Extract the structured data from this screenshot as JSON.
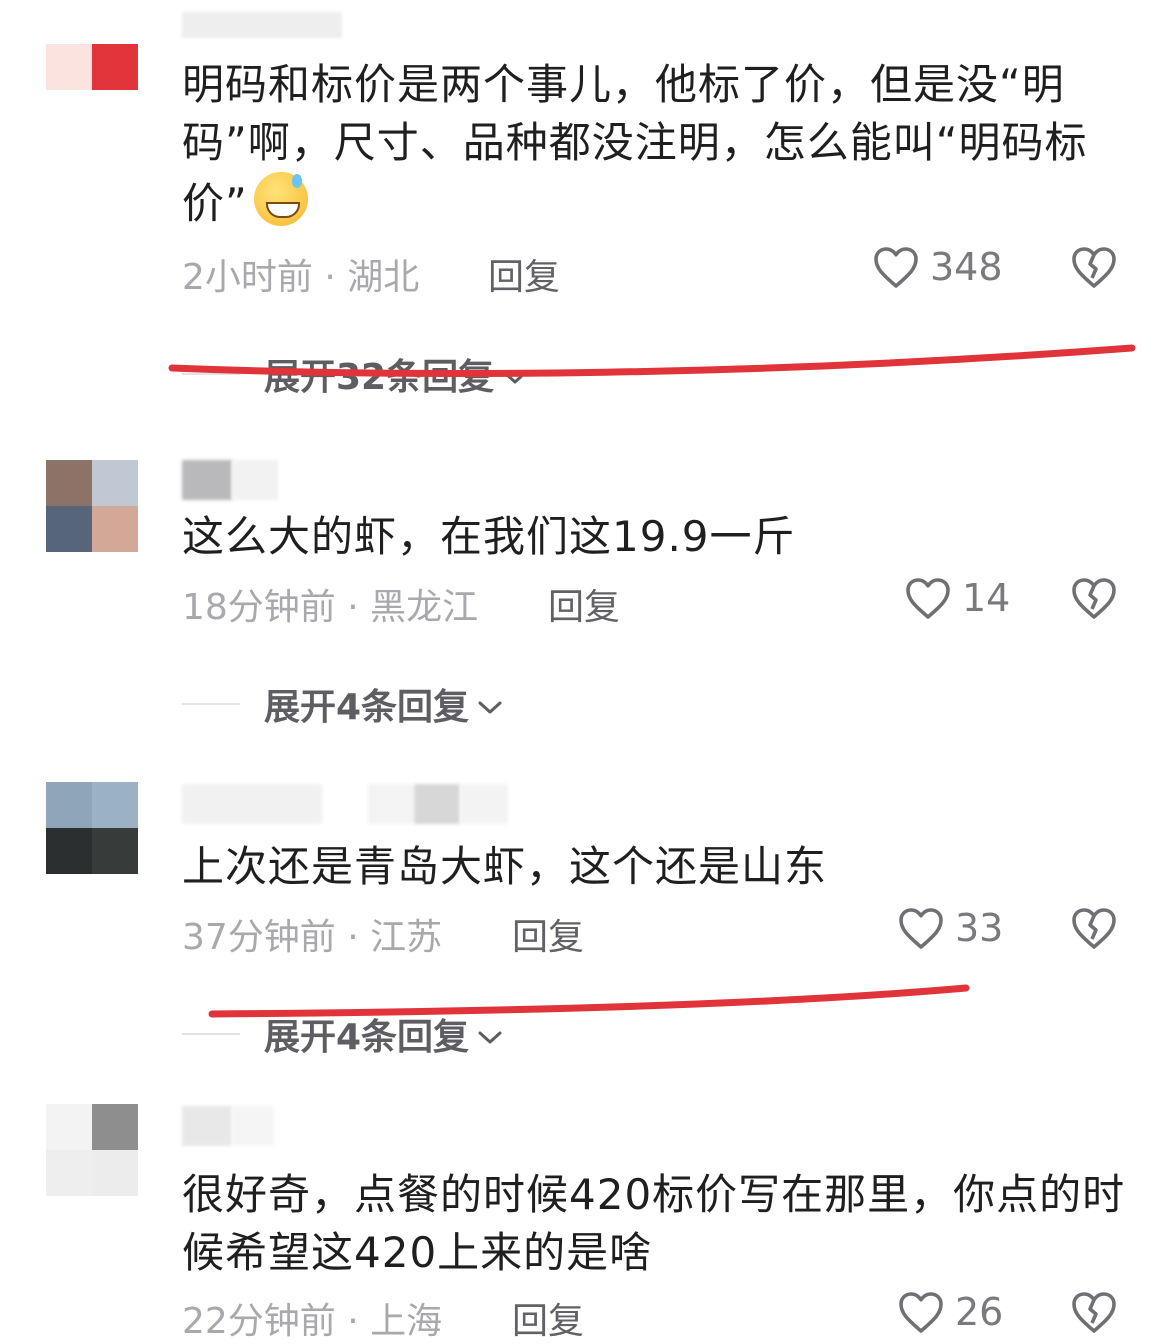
{
  "comments": [
    {
      "text": "明码和标价是两个事儿，他标了价，但是没“明码”啊，尺寸、品种都没注明，怎么能叫“明码标价”",
      "emoji": "sweat-grin-emoji",
      "time": "2小时前",
      "location": "湖北",
      "reply_label": "回复",
      "likes": "348",
      "expand_label": "展开32条回复"
    },
    {
      "text": "这么大的虾，在我们这19.9一斤",
      "time": "18分钟前",
      "location": "黑龙江",
      "reply_label": "回复",
      "likes": "14",
      "expand_label": "展开4条回复"
    },
    {
      "text": "上次还是青岛大虾，这个还是山东",
      "time": "37分钟前",
      "location": "江苏",
      "reply_label": "回复",
      "likes": "33",
      "expand_label": "展开4条回复"
    },
    {
      "text": "很好奇，点餐的时候420标价写在那里，你点的时候希望这420上来的是啥",
      "time": "22分钟前",
      "location": "上海",
      "reply_label": "回复",
      "likes": "26"
    }
  ],
  "meta_separator": " · ",
  "colors": {
    "annotation_red": "#e0343a",
    "text": "#1f1f1f",
    "meta": "#a9a9ad"
  },
  "icons": [
    "heart-icon",
    "broken-heart-icon",
    "chevron-down-icon"
  ]
}
